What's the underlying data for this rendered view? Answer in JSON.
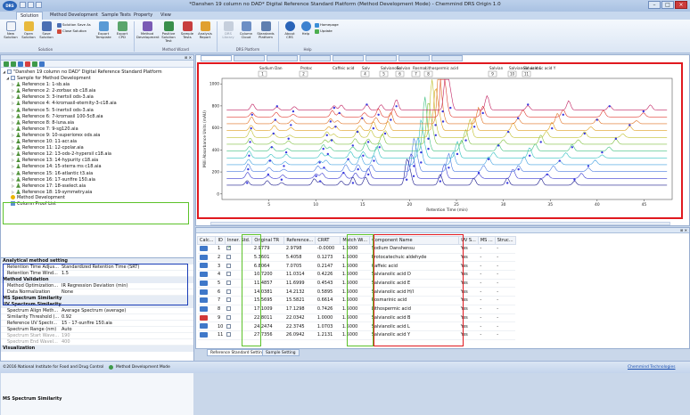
{
  "window": {
    "title": "*Danshen 19 column no DAD* Digital Reference Standard Platform (Method Development Mode) - Chemmind DRS Origin 1.0",
    "logo": "DRS"
  },
  "ribbon": {
    "tabs": [
      "Solution",
      "Method Development",
      "Sample Tests",
      "Property",
      "View"
    ],
    "active_tab": "Solution",
    "solution_group": {
      "buttons": [
        "New Solution",
        "Open Solution",
        "Save Solution"
      ],
      "small": [
        "Solution Save As",
        "Close Solution"
      ],
      "label": "Solution"
    },
    "export_buttons": [
      "Export Template",
      "Export CPD"
    ],
    "wizard_group": {
      "buttons": [
        "Method Development",
        "Positive Solution Test",
        "Sample Tests",
        "Analysis Report"
      ],
      "label": "Method Wizard"
    },
    "platform_group": {
      "buttons": [
        "DRS Library",
        "Column Cloud",
        "Standards Platform"
      ],
      "label": "DRS Platform"
    },
    "help_group": {
      "buttons": [
        "About CRS",
        "Help"
      ],
      "small": [
        "Homepage",
        "Update"
      ],
      "label": "Help"
    }
  },
  "tree": {
    "root": "\"Danshen 19 column no DAD\" Digital Reference Standard Platform",
    "sample": "Sample for Method Development",
    "references": [
      "Reference 1: 1-sb.aia",
      "Reference 2: 2-zorbax sb c18.aia",
      "Reference 3: 3-inertsil ods-3.aia",
      "Reference 4: 4-kromasil-eternity-3-c18.aia",
      "Reference 5: 5-inertsil ods-3.aia",
      "Reference 6: 7-kromasil 100-5c8.aia",
      "Reference 8: 8-luna.aia",
      "Reference 7: 9-sg120.aia",
      "Reference 9: 10-superiorex ods.aia",
      "Reference 10: 11-acr.aia",
      "Reference 11: 12-cpolar.aia",
      "Reference 12: 13-ods-2-hypersil c18.aia",
      "Reference 13: 14-hypurity c18.aia",
      "Reference 14: 15-xterra ms c18.aia",
      "Reference 15: 16-atlantic t3.aia",
      "Reference 16: 17-sunfire 150.aia",
      "Reference 17: 18-sselect.aia",
      "Reference 18: 19-symmetry.aia"
    ],
    "method_dev": "Method Development",
    "column_proof": "Column Proof List"
  },
  "properties": {
    "cat1": "Analytical method setting",
    "rows1": [
      {
        "k": "Retention Time Adjus...",
        "v": "Standardized Retention Time (SRT)"
      },
      {
        "k": "Retention Time Wind...",
        "v": "1.5"
      }
    ],
    "cat2": "Method Validation",
    "rows2": [
      {
        "k": "Method Optimization...",
        "v": "IR Regression Deviation (min)"
      },
      {
        "k": "Data Normalization",
        "v": "None"
      }
    ],
    "cat3": "MS Spectrum Similarity",
    "cat4": "UV Spectrum Similarity",
    "rows4": [
      {
        "k": "Spectrum Align Meth...",
        "v": "Average Spectrum (average)"
      },
      {
        "k": "Similarity Threshold (...",
        "v": "0.92"
      },
      {
        "k": "Reference UV Spectr...",
        "v": "15 - 17-sunfire 150.aia"
      },
      {
        "k": "Spectrum Range (nm)",
        "v": "Auto"
      },
      {
        "k": "Spectrum Start Wave...",
        "v": "190"
      },
      {
        "k": "Spectrum End Wavel...",
        "v": "400"
      }
    ],
    "cat5": "Visualization",
    "description": "MS Spectrum Similarity"
  },
  "chart_data": {
    "type": "line",
    "xlabel": "Retention Time (min)",
    "ylabel": "Milli Absorbance Units (mAU)",
    "xlim": [
      0,
      48
    ],
    "ylim": [
      -50,
      1050
    ],
    "xticks": [
      5,
      10,
      15,
      20,
      25,
      30,
      35,
      40,
      45
    ],
    "yticks": [
      0,
      200,
      400,
      600,
      800,
      1000
    ],
    "annotations": [
      {
        "text": "Sodium Dan",
        "n": "1"
      },
      {
        "text": "Protoc",
        "n": "2"
      },
      {
        "text": "Caffeic acid",
        "n": ""
      },
      {
        "text": "Salv",
        "n": "4"
      },
      {
        "text": "Salvianolic",
        "n": "5"
      },
      {
        "text": "Salvian",
        "n": "6"
      },
      {
        "text": "Rosmar",
        "n": "7"
      },
      {
        "text": "Lithospermic acid",
        "n": "8"
      },
      {
        "text": "Salvian",
        "n": "9"
      },
      {
        "text": "Salvianolic acid L",
        "n": "10"
      },
      {
        "text": "Salvianolic acid Y",
        "n": "11"
      }
    ],
    "series_colors": [
      "#1a1a8c",
      "#3b3bd0",
      "#4a7ae0",
      "#3fa0e0",
      "#30c0c0",
      "#40c080",
      "#80c040",
      "#c0c030",
      "#e0a020",
      "#e07020",
      "#e03a30",
      "#c02060"
    ],
    "marker_color": "#3a3ae0"
  },
  "grid": {
    "columns": [
      "Calc...",
      "ID",
      "Inner. Std.",
      "Original TR",
      "Reference...",
      "CRRT",
      "Match Wi...",
      "Component Name",
      "UV S...",
      "MS ...",
      "Struc..."
    ],
    "rows": [
      [
        "1",
        true,
        "2.9779",
        "2.9798",
        "-0.0000",
        "1.5000",
        "Sodium Danshensu",
        "Yes",
        "-",
        "-"
      ],
      [
        "2",
        false,
        "5.3601",
        "5.4058",
        "0.1273",
        "1.5000",
        "Protocatechuic aldehyde",
        "Yes",
        "-",
        "-"
      ],
      [
        "3",
        false,
        "6.8064",
        "7.0705",
        "0.2147",
        "1.5000",
        "Caffeic acid",
        "Yes",
        "-",
        "-"
      ],
      [
        "4",
        false,
        "10.7200",
        "11.0314",
        "0.4226",
        "1.5000",
        "Salvianolic acid D",
        "Yes",
        "-",
        "-"
      ],
      [
        "5",
        false,
        "11.4857",
        "11.6999",
        "0.4543",
        "1.5000",
        "Salvianolic acid E",
        "Yes",
        "-",
        "-"
      ],
      [
        "6",
        false,
        "14.0381",
        "14.2132",
        "0.5895",
        "1.5000",
        "Salvianolic acid H/I",
        "Yes",
        "-",
        "-"
      ],
      [
        "7",
        false,
        "15.5695",
        "15.5821",
        "0.6614",
        "1.5000",
        "Rosmarinic acid",
        "Yes",
        "-",
        "-"
      ],
      [
        "8",
        false,
        "17.1009",
        "17.1298",
        "0.7426",
        "1.5000",
        "Lithospermic acid",
        "Yes",
        "-",
        "-"
      ],
      [
        "9",
        false,
        "22.8011",
        "22.0342",
        "1.0000",
        "1.5000",
        "Salvianolic acid B",
        "Yes",
        "-",
        "-"
      ],
      [
        "10",
        false,
        "24.2474",
        "22.3745",
        "1.0703",
        "1.5000",
        "Salvianolic acid L",
        "Yes",
        "-",
        "-"
      ],
      [
        "11",
        false,
        "27.7356",
        "26.0942",
        "1.2131",
        "1.5000",
        "Salvianolic acid Y",
        "Yes",
        "-",
        "-"
      ]
    ],
    "bottom_tabs": [
      "Reference Standard Setting",
      "Sample Setting"
    ]
  },
  "status": {
    "copyright": "©2016 National Institute for Food and Drug Control",
    "mode": "Method Development Mode",
    "link": "Chemmind Technologies"
  }
}
